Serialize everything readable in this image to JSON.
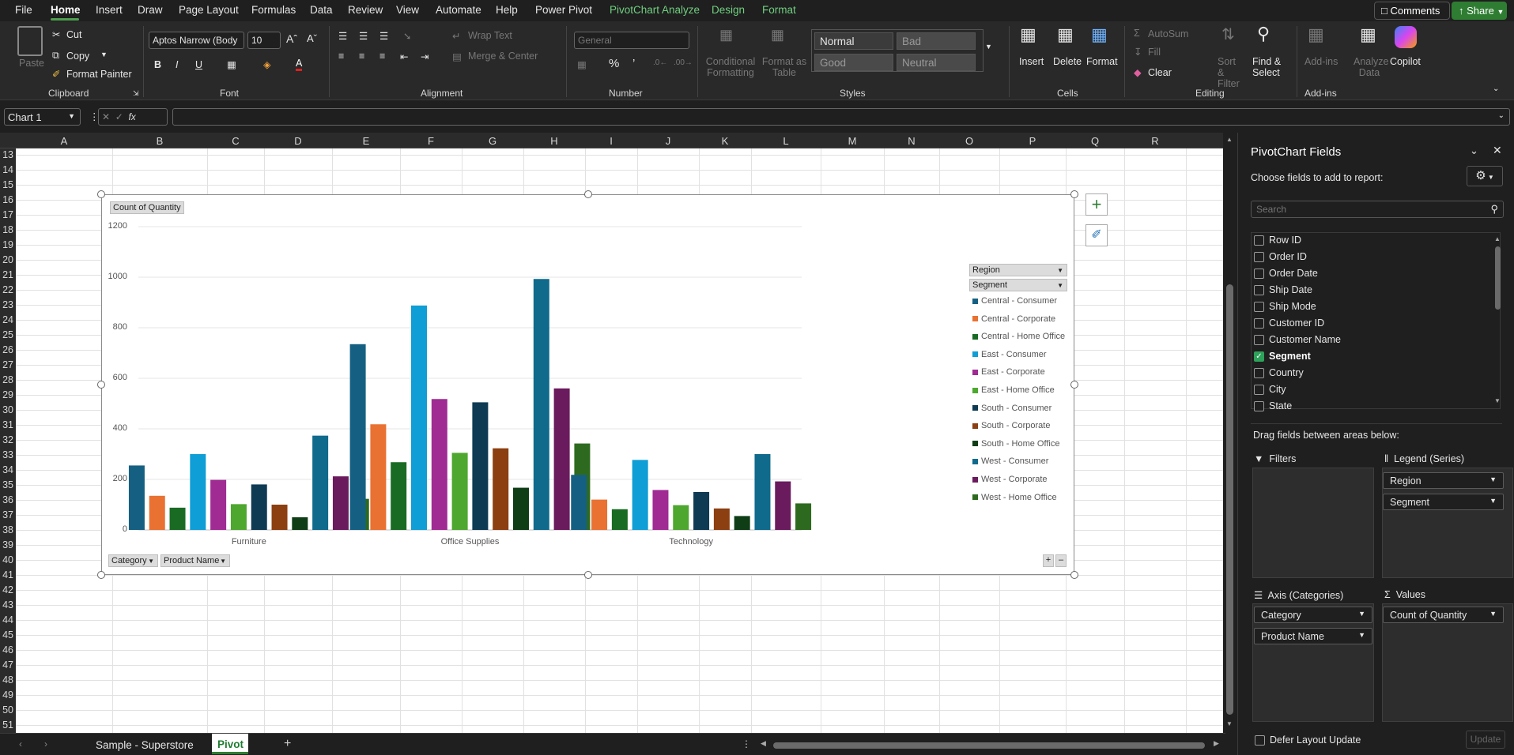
{
  "menubar": {
    "tabs": [
      "File",
      "Home",
      "Insert",
      "Draw",
      "Page Layout",
      "Formulas",
      "Data",
      "Review",
      "View",
      "Automate",
      "Help",
      "Power Pivot",
      "PivotChart Analyze",
      "Design",
      "Format"
    ],
    "comments_label": "Comments",
    "share_label": "Share"
  },
  "ribbon": {
    "clipboard": {
      "paste": "Paste",
      "cut": "Cut",
      "copy": "Copy",
      "format_painter": "Format Painter",
      "label": "Clipboard"
    },
    "font": {
      "name": "Aptos Narrow (Body",
      "size": "10",
      "label": "Font",
      "bold": "B",
      "italic": "I",
      "underline": "U"
    },
    "alignment": {
      "wrap": "Wrap Text",
      "merge": "Merge & Center",
      "label": "Alignment"
    },
    "number": {
      "format": "General",
      "label": "Number"
    },
    "styles": {
      "cond": "Conditional Formatting",
      "table": "Format as Table",
      "normal": "Normal",
      "bad": "Bad",
      "good": "Good",
      "neutral": "Neutral",
      "label": "Styles"
    },
    "cells": {
      "insert": "Insert",
      "delete": "Delete",
      "format": "Format",
      "label": "Cells"
    },
    "editing": {
      "autosum": "AutoSum",
      "fill": "Fill",
      "clear": "Clear",
      "sort": "Sort & Filter",
      "find": "Find & Select",
      "label": "Editing"
    },
    "addins": {
      "addins": "Add-ins",
      "analyze": "Analyze Data",
      "copilot": "Copilot",
      "label": "Add-ins"
    }
  },
  "formula_bar": {
    "name_box": "Chart 1",
    "value": ""
  },
  "columns": [
    "A",
    "B",
    "C",
    "D",
    "E",
    "F",
    "G",
    "H",
    "I",
    "J",
    "K",
    "L",
    "M",
    "N",
    "O",
    "P",
    "Q",
    "R"
  ],
  "rows": [
    "13",
    "14",
    "15",
    "16",
    "17",
    "18",
    "19",
    "20",
    "21",
    "22",
    "23",
    "24",
    "25",
    "26",
    "27",
    "28",
    "29",
    "30",
    "31",
    "32",
    "33",
    "34",
    "35",
    "36",
    "37",
    "38",
    "39",
    "40",
    "41",
    "42",
    "43",
    "44",
    "45",
    "46",
    "47",
    "48",
    "49",
    "50",
    "51"
  ],
  "chart_data": {
    "type": "bar",
    "value_button": "Count of Quantity",
    "legend_filters": [
      "Region",
      "Segment"
    ],
    "axis_filters": [
      "Category",
      "Product Name"
    ],
    "categories": [
      "Furniture",
      "Office Supplies",
      "Technology"
    ],
    "ylim": [
      0,
      1200
    ],
    "yticks": [
      "1200",
      "1000",
      "800",
      "600",
      "400",
      "200",
      "0"
    ],
    "grid": true,
    "legend_position": "right",
    "series": [
      {
        "name": "Central - Consumer",
        "color": "#156082",
        "values": [
          255,
          735,
          218
        ]
      },
      {
        "name": "Central - Corporate",
        "color": "#e97132",
        "values": [
          135,
          418,
          120
        ]
      },
      {
        "name": "Central - Home Office",
        "color": "#196b24",
        "values": [
          88,
          268,
          82
        ]
      },
      {
        "name": "East - Consumer",
        "color": "#0f9ed5",
        "values": [
          300,
          888,
          277
        ]
      },
      {
        "name": "East - Corporate",
        "color": "#a02b93",
        "values": [
          198,
          518,
          158
        ]
      },
      {
        "name": "East - Home Office",
        "color": "#4ea72e",
        "values": [
          102,
          305,
          98
        ]
      },
      {
        "name": "South - Consumer",
        "color": "#0e3a53",
        "values": [
          180,
          505,
          150
        ]
      },
      {
        "name": "South - Corporate",
        "color": "#8c3f11",
        "values": [
          100,
          323,
          85
        ]
      },
      {
        "name": "South - Home Office",
        "color": "#0f3d16",
        "values": [
          50,
          167,
          55
        ]
      },
      {
        "name": "West - Consumer",
        "color": "#0f6a8c",
        "values": [
          373,
          993,
          300
        ]
      },
      {
        "name": "West - Corporate",
        "color": "#6a1b5d",
        "values": [
          212,
          560,
          192
        ]
      },
      {
        "name": "West - Home Office",
        "color": "#2d6a1f",
        "values": [
          123,
          342,
          105
        ]
      }
    ]
  },
  "sheet_tabs": {
    "tabs": [
      "Sample - Superstore",
      "Pivot"
    ],
    "active": "Pivot"
  },
  "pivot_pane": {
    "title": "PivotChart Fields",
    "subtitle": "Choose fields to add to report:",
    "search_placeholder": "Search",
    "fields": [
      {
        "name": "Row ID",
        "checked": false
      },
      {
        "name": "Order ID",
        "checked": false
      },
      {
        "name": "Order Date",
        "checked": false
      },
      {
        "name": "Ship Date",
        "checked": false
      },
      {
        "name": "Ship Mode",
        "checked": false
      },
      {
        "name": "Customer ID",
        "checked": false
      },
      {
        "name": "Customer Name",
        "checked": false
      },
      {
        "name": "Segment",
        "checked": true
      },
      {
        "name": "Country",
        "checked": false
      },
      {
        "name": "City",
        "checked": false
      },
      {
        "name": "State",
        "checked": false
      }
    ],
    "drag_label": "Drag fields between areas below:",
    "filters_label": "Filters",
    "legend_label": "Legend (Series)",
    "legend_items": [
      "Region",
      "Segment"
    ],
    "axis_label": "Axis (Categories)",
    "axis_items": [
      "Category",
      "Product Name"
    ],
    "values_label": "Values",
    "values_items": [
      "Count of Quantity"
    ],
    "defer_label": "Defer Layout Update",
    "update_label": "Update"
  }
}
